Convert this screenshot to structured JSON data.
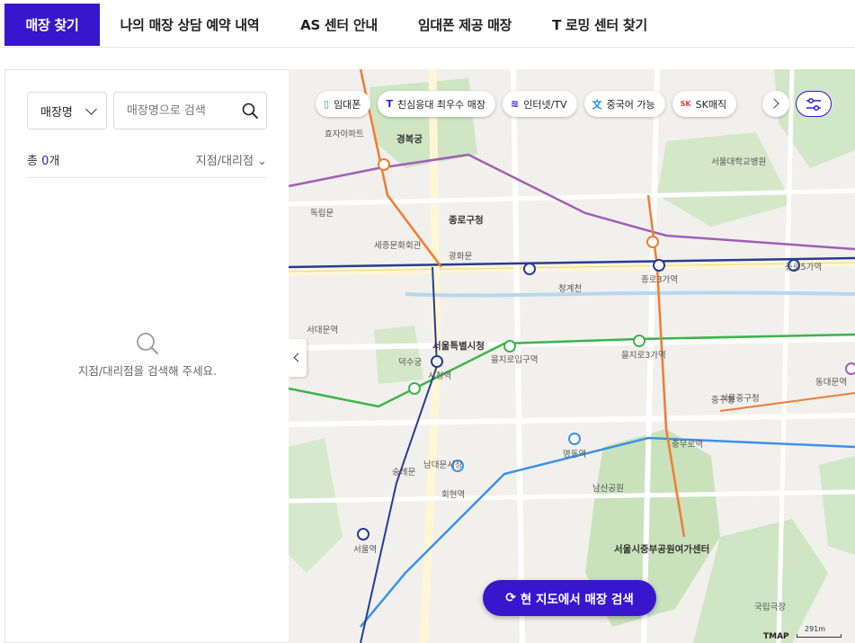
{
  "tabs": [
    {
      "label": "매장 찾기",
      "active": true
    },
    {
      "label": "나의 매장 상담 예약 내역",
      "active": false
    },
    {
      "label": "AS 센터 안내",
      "active": false
    },
    {
      "label": "임대폰 제공 매장",
      "active": false
    },
    {
      "label": "T 로밍 센터 찾기",
      "active": false
    }
  ],
  "panel": {
    "select": {
      "value": "매장명"
    },
    "search": {
      "placeholder": "매장명으로 검색",
      "value": ""
    },
    "count": {
      "prefix": "총 ",
      "number": "0",
      "unit": "개"
    },
    "sort_label": "지점/대리점",
    "empty_message": "지점/대리점을 검색해 주세요."
  },
  "map": {
    "chips": [
      {
        "icon": "rental-phone-icon",
        "glyph": "▯",
        "label": "임대폰",
        "color": "#2aa84a"
      },
      {
        "icon": "t-logo-icon",
        "glyph": "T",
        "label": "친심응대 최우수 매장",
        "color": "#3617ce"
      },
      {
        "icon": "router-icon",
        "glyph": "≋",
        "label": "인터넷/TV",
        "color": "#3617ce"
      },
      {
        "icon": "chinese-icon",
        "glyph": "文",
        "label": "중국어 가능",
        "color": "#1e88e5"
      },
      {
        "icon": "sk-logo-icon",
        "glyph": "SK",
        "label": "SK매직",
        "color": "#e53935"
      }
    ],
    "search_area_button": "현 지도에서 매장 검색",
    "provider": "TMAP",
    "scale": "291m",
    "labels": [
      "효자아파트",
      "서울대학교병원",
      "경복궁",
      "종로구청",
      "세종문화회관",
      "광화문",
      "서울특별시청",
      "시청역",
      "을지로입구역",
      "명동역",
      "서울역",
      "남산공원",
      "종로3가역",
      "충무로역",
      "동대문역",
      "중구청",
      "독립문",
      "서대문역",
      "덕수궁",
      "서울중구청",
      "서울시중부공원여가센터",
      "국립극장",
      "청계천",
      "종로5가역",
      "을지로3가역",
      "남대문시장",
      "회현역",
      "숭례문"
    ]
  },
  "colors": {
    "brand": "#3617ce"
  }
}
